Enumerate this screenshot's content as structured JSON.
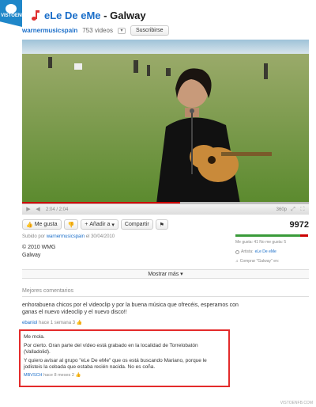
{
  "badge": {
    "text": "VISTOENFB.COM"
  },
  "header": {
    "band": "eLe De eMe",
    "title_suffix": " - Galway"
  },
  "channel": {
    "name": "warnermusicspain",
    "videos": "753 videos",
    "subscribe_label": "Suscribirse"
  },
  "player": {
    "time": "2:04 / 2:04",
    "quality": "360p",
    "progress": 0.55
  },
  "actions": {
    "like": "Me gusta",
    "add": "Añadir a",
    "share": "Compartir",
    "views": "9972"
  },
  "upload": {
    "prefix": "Subido por",
    "user": "warnermusicspain",
    "date": "el 30/04/2010"
  },
  "description": {
    "line1": "© 2010 WMG",
    "line2": "Galway"
  },
  "ratings": {
    "text": "Me gusta: 41 No me gusta: 5",
    "like_fraction": 0.89,
    "artist_label": "Artista:",
    "artist": "eLe De eMe",
    "buy": "Comprar \"Galway\" en:"
  },
  "more_label": "Mostrar más",
  "comments": {
    "heading": "Mejores comentarios",
    "first": {
      "text": "enhorabuena chicos por el videoclip y por la buena música que ofrecéis, esperamos con ganas el nuevo videoclip y el nuevo disco!!",
      "user": "ebaniol",
      "when": "hace 1 semana",
      "likes": "3"
    },
    "highlight": {
      "p1": "Me mola.",
      "p2": "Por cierto. Gran parte del vídeo está grabado en la localidad de Torrelobatón (Valladolid).",
      "p3": "Y quiero avisar al grupo \"eLe De eMe\" que os está buscando Mariano, porque le jodisteis la cebada que estaba recién nacida. No es coña.",
      "user": "MBVSCH",
      "when": "hace 8 meses",
      "likes": "2"
    }
  },
  "footer": "VISTOENFB.COM"
}
